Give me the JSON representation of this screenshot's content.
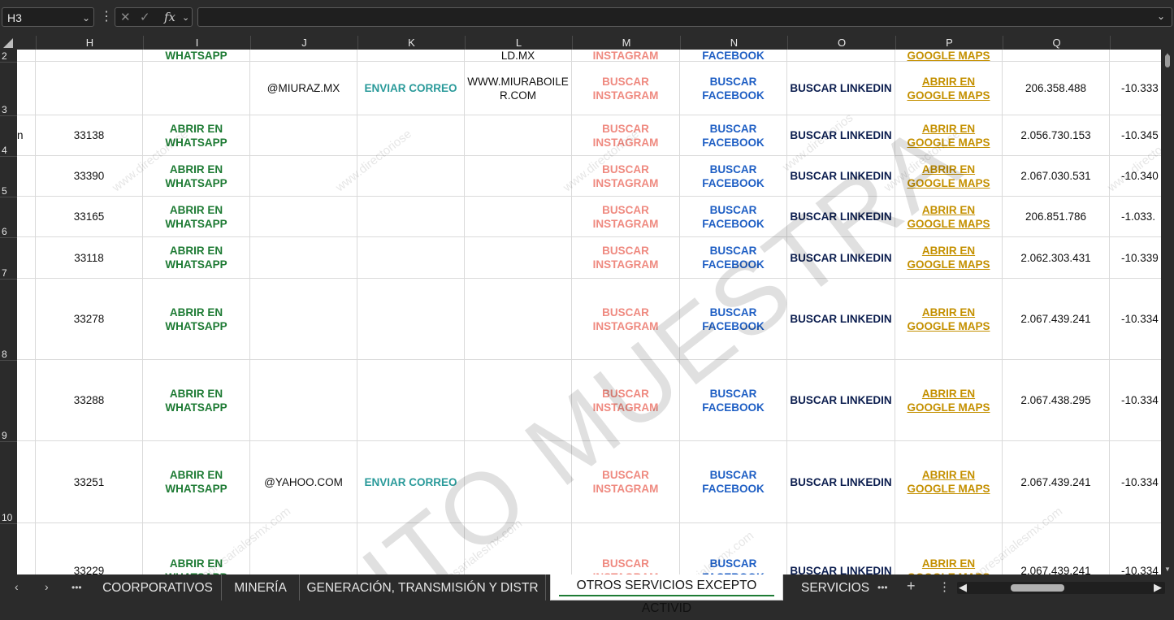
{
  "formula_bar": {
    "name_box": "H3",
    "fx_label": "fx",
    "formula": ""
  },
  "columns": [
    "H",
    "I",
    "J",
    "K",
    "L",
    "M",
    "N",
    "O",
    "P",
    "Q"
  ],
  "row_numbers": [
    "2",
    "3",
    "4",
    "5",
    "6",
    "7",
    "8",
    "9",
    "10"
  ],
  "rows": [
    {
      "row": "2",
      "a": "",
      "h": "",
      "i": "WHATSAPP",
      "j": "",
      "k": "",
      "l": "LD.MX",
      "m": "INSTAGRAM",
      "n": "FACEBOOK",
      "o": "",
      "p": "GOOGLE MAPS",
      "q": "",
      "r": ""
    },
    {
      "row": "3",
      "a": "",
      "h": "",
      "i": "",
      "j": "@MIURAZ.MX",
      "k": "ENVIAR CORREO",
      "l": "WWW.MIURABOILE\nR.COM",
      "m": "BUSCAR\nINSTAGRAM",
      "n": "BUSCAR\nFACEBOOK",
      "o": "BUSCAR LINKEDIN",
      "p": "ABRIR EN\nGOOGLE MAPS",
      "q": "206.358.488",
      "r": "-10.333"
    },
    {
      "row": "4",
      "a": "n",
      "h": "33138",
      "i": "ABRIR EN\nWHATSAPP",
      "j": "",
      "k": "",
      "l": "",
      "m": "BUSCAR\nINSTAGRAM",
      "n": "BUSCAR\nFACEBOOK",
      "o": "BUSCAR LINKEDIN",
      "p": "ABRIR EN\nGOOGLE MAPS",
      "q": "2.056.730.153",
      "r": "-10.345"
    },
    {
      "row": "5",
      "a": "",
      "h": "33390",
      "i": "ABRIR EN\nWHATSAPP",
      "j": "",
      "k": "",
      "l": "",
      "m": "BUSCAR\nINSTAGRAM",
      "n": "BUSCAR\nFACEBOOK",
      "o": "BUSCAR LINKEDIN",
      "p": "ABRIR EN\nGOOGLE MAPS",
      "q": "2.067.030.531",
      "r": "-10.340"
    },
    {
      "row": "6",
      "a": "",
      "h": "33165",
      "i": "ABRIR EN\nWHATSAPP",
      "j": "",
      "k": "",
      "l": "",
      "m": "BUSCAR\nINSTAGRAM",
      "n": "BUSCAR\nFACEBOOK",
      "o": "BUSCAR LINKEDIN",
      "p": "ABRIR EN\nGOOGLE MAPS",
      "q": "206.851.786",
      "r": "-1.033."
    },
    {
      "row": "7",
      "a": "",
      "h": "33118",
      "i": "ABRIR EN\nWHATSAPP",
      "j": "",
      "k": "",
      "l": "",
      "m": "BUSCAR\nINSTAGRAM",
      "n": "BUSCAR\nFACEBOOK",
      "o": "BUSCAR LINKEDIN",
      "p": "ABRIR EN\nGOOGLE MAPS",
      "q": "2.062.303.431",
      "r": "-10.339"
    },
    {
      "row": "8",
      "a": "",
      "h": "33278",
      "i": "ABRIR EN\nWHATSAPP",
      "j": "",
      "k": "",
      "l": "",
      "m": "BUSCAR\nINSTAGRAM",
      "n": "BUSCAR\nFACEBOOK",
      "o": "BUSCAR LINKEDIN",
      "p": "ABRIR EN\nGOOGLE MAPS",
      "q": "2.067.439.241",
      "r": "-10.334"
    },
    {
      "row": "9",
      "a": "",
      "h": "33288",
      "i": "ABRIR EN\nWHATSAPP",
      "j": "",
      "k": "",
      "l": "",
      "m": "BUSCAR\nINSTAGRAM",
      "n": "BUSCAR\nFACEBOOK",
      "o": "BUSCAR LINKEDIN",
      "p": "ABRIR EN\nGOOGLE MAPS",
      "q": "2.067.438.295",
      "r": "-10.334"
    },
    {
      "row": "10",
      "a": "",
      "h": "33251",
      "i": "ABRIR EN\nWHATSAPP",
      "j": "@YAHOO.COM",
      "k": "ENVIAR CORREO",
      "l": "",
      "m": "BUSCAR\nINSTAGRAM",
      "n": "BUSCAR\nFACEBOOK",
      "o": "BUSCAR LINKEDIN",
      "p": "ABRIR EN\nGOOGLE MAPS",
      "q": "2.067.439.241",
      "r": "-10.334"
    },
    {
      "row": "",
      "a": "",
      "h": "33229",
      "i": "ABRIR EN\nWHATSAPP",
      "j": "",
      "k": "",
      "l": "",
      "m": "BUSCAR\nINSTAGRAM",
      "n": "BUSCAR\nFACEBOOK",
      "o": "BUSCAR LINKEDIN",
      "p": "ABRIR EN\nGOOGLE MAPS",
      "q": "2.067.439.241",
      "r": "-10.334"
    }
  ],
  "watermarks": {
    "small": [
      "www.directoriose",
      "www.directoriose",
      "www.directoriose",
      "www.directorios",
      "www.directo",
      "www.directoriose",
      "empresarialesmx.com",
      "empresarialesmx.com",
      "empresarialesmx.com",
      "empresarialesmx.com"
    ],
    "big": "ITO MUESTRA"
  },
  "sheet_tabs": {
    "more_label": "•••",
    "tabs": [
      "COORPORATIVOS",
      "MINERÍA",
      "GENERACIÓN, TRANSMISIÓN Y DISTR",
      "OTROS SERVICIOS EXCEPTO ACTIVID",
      "SERVICIOS I"
    ],
    "active_index": 3,
    "add_label": "+"
  }
}
